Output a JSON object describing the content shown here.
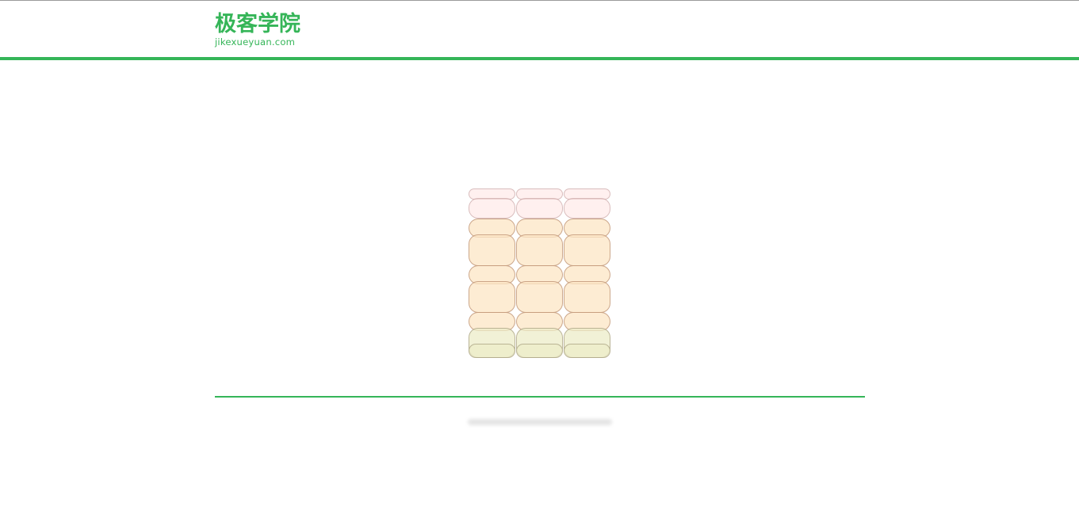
{
  "header": {
    "logo_cn": "极客学院",
    "logo_en": "jikexueyuan.com",
    "accent_color": "#35b558"
  },
  "demo": {
    "cube_colors": {
      "pink": "#ffe4e1",
      "orange": "#fce6c4",
      "olive": "#ececc8"
    }
  }
}
